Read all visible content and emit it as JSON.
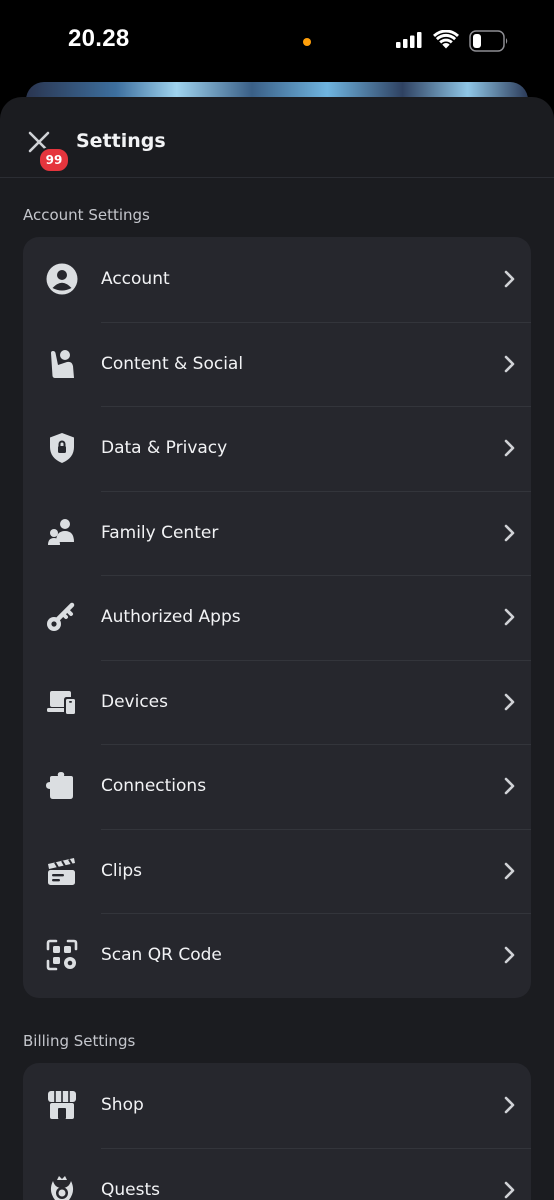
{
  "status_bar": {
    "time": "20.28",
    "recording_dot_color": "#ff9f0a",
    "icons": [
      "cellular-signal-icon",
      "wifi-icon",
      "battery-icon"
    ]
  },
  "header": {
    "title": "Settings",
    "close_icon": "close-icon",
    "badge_count": "99",
    "badge_color": "#e5353d"
  },
  "account_settings": {
    "label": "Account Settings",
    "items": [
      {
        "label": "Account",
        "icon": "account-icon"
      },
      {
        "label": "Content & Social",
        "icon": "content-social-icon"
      },
      {
        "label": "Data & Privacy",
        "icon": "shield-lock-icon"
      },
      {
        "label": "Family Center",
        "icon": "family-icon"
      },
      {
        "label": "Authorized Apps",
        "icon": "key-icon"
      },
      {
        "label": "Devices",
        "icon": "devices-icon"
      },
      {
        "label": "Connections",
        "icon": "puzzle-icon"
      },
      {
        "label": "Clips",
        "icon": "clapperboard-icon"
      },
      {
        "label": "Scan QR Code",
        "icon": "qr-code-icon"
      }
    ]
  },
  "billing_settings": {
    "label": "Billing Settings",
    "items": [
      {
        "label": "Shop",
        "icon": "shop-icon"
      },
      {
        "label": "Quests",
        "icon": "quests-icon"
      }
    ]
  }
}
